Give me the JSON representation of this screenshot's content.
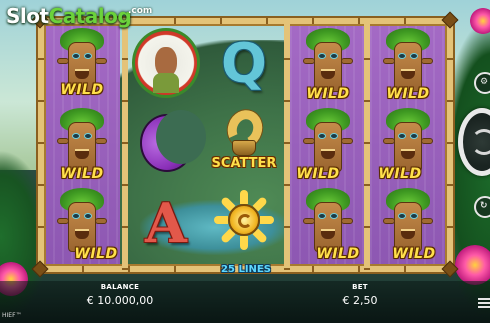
{
  "logo": {
    "text_white": "Slot",
    "text_green": "Catalog",
    "suffix": ".com"
  },
  "reels": [
    {
      "type": "wild-reel",
      "symbols": [
        "totem-wild",
        "totem-wild",
        "totem-wild"
      ]
    },
    {
      "type": "regular",
      "symbols": [
        "chief-portrait",
        "purple-moon",
        "letter-a"
      ]
    },
    {
      "type": "regular",
      "symbols": [
        "letter-q",
        "golden-horn-scatter",
        "golden-sun"
      ]
    },
    {
      "type": "wild-reel",
      "symbols": [
        "totem-wild",
        "totem-wild",
        "totem-wild"
      ]
    },
    {
      "type": "wild-reel",
      "symbols": [
        "totem-wild",
        "totem-wild",
        "totem-wild"
      ]
    }
  ],
  "labels": {
    "wild": "WILD",
    "scatter": "SCATTER",
    "letter_a": "A",
    "letter_q": "Q"
  },
  "lines_banner": "25 LINES",
  "balance": {
    "label": "BALANCE",
    "value": "€ 10.000,00"
  },
  "bet": {
    "label": "BET",
    "value": "€ 2,50"
  },
  "brand_fragment": "HIEF™",
  "icons": [
    "spin-icon",
    "autoplay-icon",
    "settings-icon",
    "menu-icon"
  ],
  "colors": {
    "wild_text": "#ffe04a",
    "reel_purple": "#9a60bd",
    "frame_bamboo": "#d8b266",
    "lines_text": "#5fd9ff"
  }
}
